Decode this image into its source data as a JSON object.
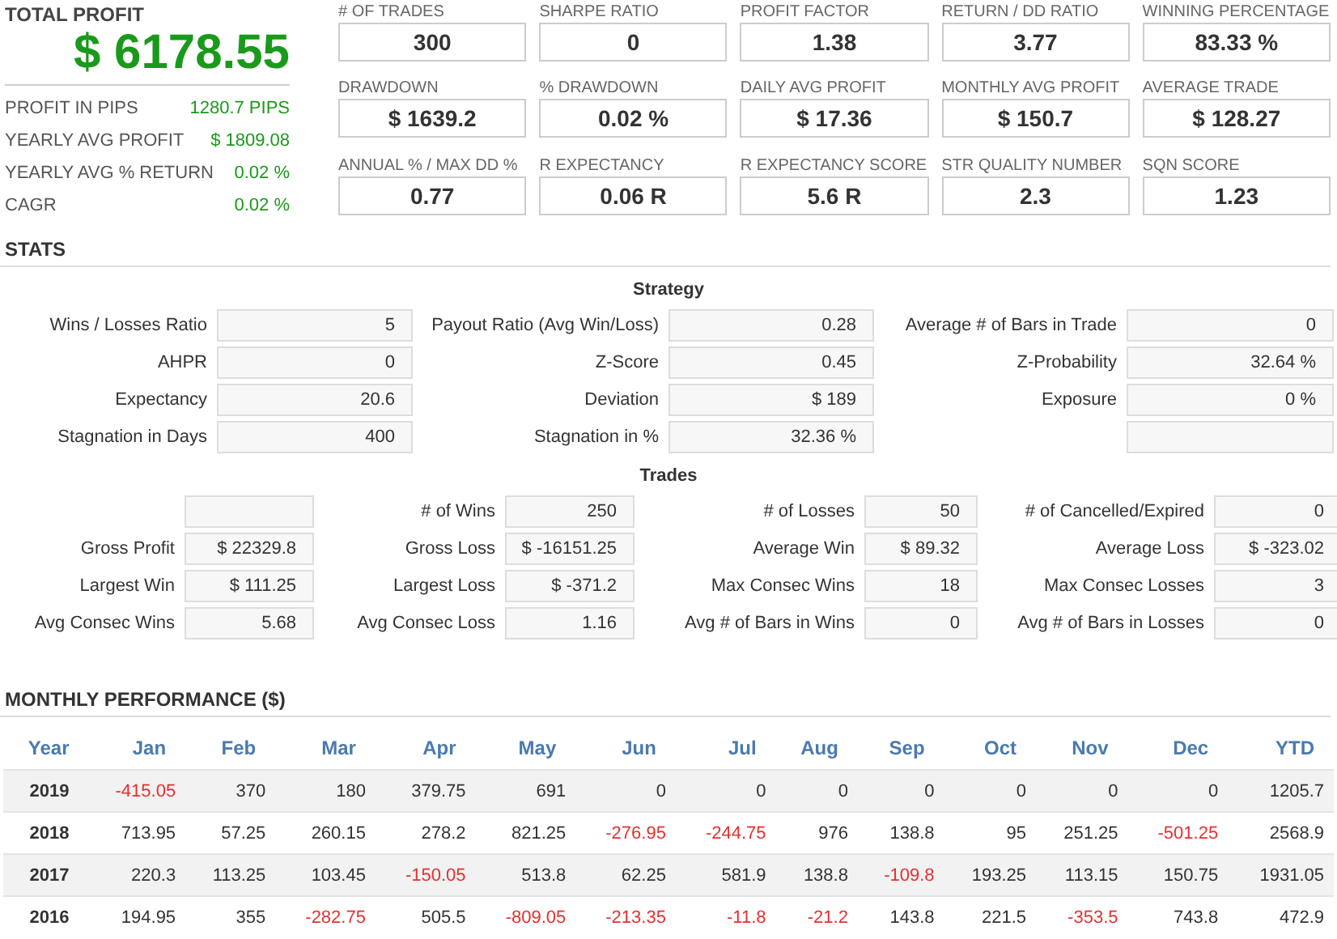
{
  "summary": {
    "title": "TOTAL PROFIT",
    "total": "$ 6178.55",
    "rows": [
      {
        "label": "PROFIT IN PIPS",
        "value": "1280.7 PIPS"
      },
      {
        "label": "YEARLY AVG PROFIT",
        "value": "$ 1809.08"
      },
      {
        "label": "YEARLY AVG % RETURN",
        "value": "0.02 %"
      },
      {
        "label": "CAGR",
        "value": "0.02 %"
      }
    ]
  },
  "metrics": [
    {
      "label": "# OF TRADES",
      "value": "300"
    },
    {
      "label": "SHARPE RATIO",
      "value": "0"
    },
    {
      "label": "PROFIT FACTOR",
      "value": "1.38"
    },
    {
      "label": "RETURN / DD RATIO",
      "value": "3.77"
    },
    {
      "label": "WINNING PERCENTAGE",
      "value": "83.33 %"
    },
    {
      "label": "DRAWDOWN",
      "value": "$ 1639.2"
    },
    {
      "label": "% DRAWDOWN",
      "value": "0.02 %"
    },
    {
      "label": "DAILY AVG PROFIT",
      "value": "$ 17.36"
    },
    {
      "label": "MONTHLY AVG PROFIT",
      "value": "$ 150.7"
    },
    {
      "label": "AVERAGE TRADE",
      "value": "$ 128.27"
    },
    {
      "label": "ANNUAL % / MAX DD %",
      "value": "0.77"
    },
    {
      "label": "R EXPECTANCY",
      "value": "0.06 R"
    },
    {
      "label": "R EXPECTANCY SCORE",
      "value": "5.6 R"
    },
    {
      "label": "STR QUALITY NUMBER",
      "value": "2.3"
    },
    {
      "label": "SQN SCORE",
      "value": "1.23"
    }
  ],
  "stats": {
    "title": "STATS",
    "strategy": {
      "title": "Strategy",
      "cells": [
        {
          "label": "Wins / Losses Ratio",
          "value": "5"
        },
        {
          "label": "Payout Ratio (Avg Win/Loss)",
          "value": "0.28"
        },
        {
          "label": "Average # of Bars in Trade",
          "value": "0"
        },
        {
          "label": "AHPR",
          "value": "0"
        },
        {
          "label": "Z-Score",
          "value": "0.45"
        },
        {
          "label": "Z-Probability",
          "value": "32.64 %"
        },
        {
          "label": "Expectancy",
          "value": "20.6"
        },
        {
          "label": "Deviation",
          "value": "$ 189"
        },
        {
          "label": "Exposure",
          "value": "0 %"
        },
        {
          "label": "Stagnation in Days",
          "value": "400"
        },
        {
          "label": "Stagnation in %",
          "value": "32.36 %"
        },
        {}
      ]
    },
    "trades": {
      "title": "Trades",
      "cells": [
        {},
        {
          "label": "# of Wins",
          "value": "250"
        },
        {
          "label": "# of Losses",
          "value": "50"
        },
        {
          "label": "# of Cancelled/Expired",
          "value": "0"
        },
        {
          "label": "Gross Profit",
          "value": "$ 22329.8"
        },
        {
          "label": "Gross Loss",
          "value": "$ -16151.25"
        },
        {
          "label": "Average Win",
          "value": "$ 89.32"
        },
        {
          "label": "Average Loss",
          "value": "$ -323.02"
        },
        {
          "label": "Largest Win",
          "value": "$ 111.25"
        },
        {
          "label": "Largest Loss",
          "value": "$ -371.2"
        },
        {
          "label": "Max Consec Wins",
          "value": "18"
        },
        {
          "label": "Max Consec Losses",
          "value": "3"
        },
        {
          "label": "Avg Consec Wins",
          "value": "5.68"
        },
        {
          "label": "Avg Consec Loss",
          "value": "1.16"
        },
        {
          "label": "Avg # of Bars in Wins",
          "value": "0"
        },
        {
          "label": "Avg # of Bars in Losses",
          "value": "0"
        }
      ]
    }
  },
  "monthly": {
    "title": "MONTHLY PERFORMANCE ($)",
    "columns": [
      "Year",
      "Jan",
      "Feb",
      "Mar",
      "Apr",
      "May",
      "Jun",
      "Jul",
      "Aug",
      "Sep",
      "Oct",
      "Nov",
      "Dec",
      "YTD"
    ],
    "rows": [
      [
        "2019",
        "-415.05",
        "370",
        "180",
        "379.75",
        "691",
        "0",
        "0",
        "0",
        "0",
        "0",
        "0",
        "0",
        "1205.7"
      ],
      [
        "2018",
        "713.95",
        "57.25",
        "260.15",
        "278.2",
        "821.25",
        "-276.95",
        "-244.75",
        "976",
        "138.8",
        "95",
        "251.25",
        "-501.25",
        "2568.9"
      ],
      [
        "2017",
        "220.3",
        "113.25",
        "103.45",
        "-150.05",
        "513.8",
        "62.25",
        "581.9",
        "138.8",
        "-109.8",
        "193.25",
        "113.15",
        "150.75",
        "1931.05"
      ],
      [
        "2016",
        "194.95",
        "355",
        "-282.75",
        "505.5",
        "-809.05",
        "-213.35",
        "-11.8",
        "-21.2",
        "143.8",
        "221.5",
        "-353.5",
        "743.8",
        "472.9"
      ]
    ]
  }
}
